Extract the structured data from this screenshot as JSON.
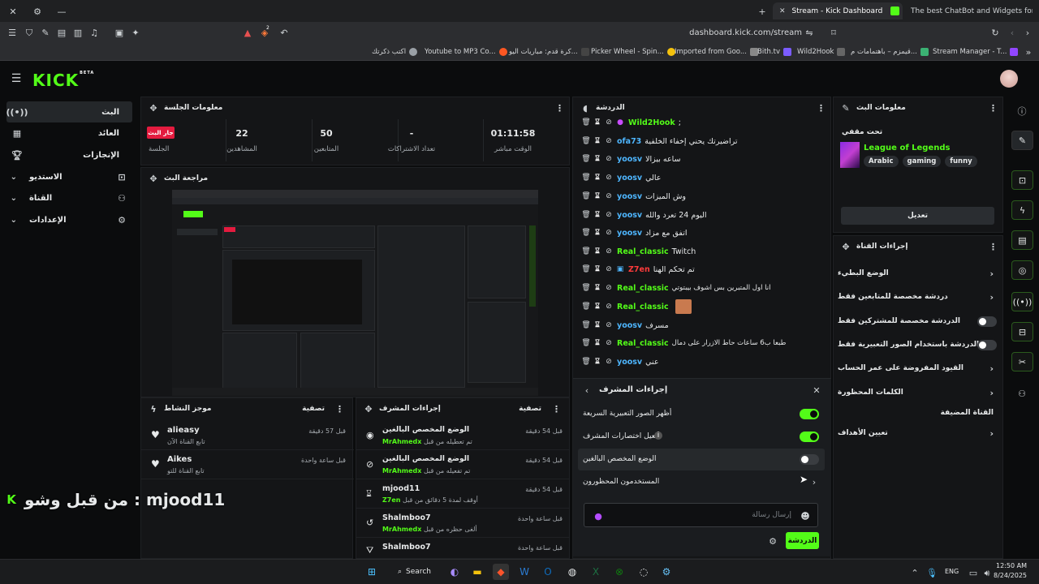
{
  "browser": {
    "tabs": [
      {
        "title": "Stream - Kick Dashboard",
        "active": true
      },
      {
        "title": "The best ChatBot and Widgets for Ki",
        "active": false
      }
    ],
    "address": "dashboard.kick.com/stream",
    "bookmarks": [
      "اكتب ذكرتك",
      "Youtube to MP3 Co...",
      "كرة قدم: مباريات اليو...",
      "Picker Wheel - Spin...",
      "Imported from Goo...",
      "Bith.tv",
      "Wild2Hook",
      "قيمزم – باهتمامات م...",
      "Stream Manager - T..."
    ],
    "ext_badge": "2"
  },
  "app": {
    "logo": "KICK",
    "logo_sup": "BETA"
  },
  "nav": [
    {
      "label": "البث",
      "icon": "broadcast-icon",
      "active": true,
      "chevron": false
    },
    {
      "label": "العائد",
      "icon": "calendar-icon",
      "active": false,
      "chevron": false
    },
    {
      "label": "الإنجازات",
      "icon": "trophy-icon",
      "active": false,
      "chevron": false
    },
    {
      "label": "الاستديو",
      "icon": "studio-icon",
      "active": false,
      "chevron": true
    },
    {
      "label": "القناة",
      "icon": "users-icon",
      "active": false,
      "chevron": true
    },
    {
      "label": "الإعدادات",
      "icon": "gear-icon",
      "active": false,
      "chevron": true
    }
  ],
  "session": {
    "title": "معلومات الجلسة",
    "live_badge": "جار البث",
    "stats": [
      {
        "value": "",
        "label": "الجلسة"
      },
      {
        "value": "22",
        "label": "المشاهدين"
      },
      {
        "value": "50",
        "label": "المتابعين"
      },
      {
        "value": "-",
        "label": "تعداد الاشتراكات"
      },
      {
        "value": "01:11:58",
        "label": "الوقت مباشر"
      }
    ]
  },
  "preview": {
    "title": "مراجعة البث"
  },
  "chat": {
    "title": "الدردشة",
    "messages": [
      {
        "user": "Wild2Hook",
        "color": "green",
        "text": ";",
        "mod": true
      },
      {
        "user": "ofa73",
        "color": "blue",
        "text": "تراضيرتك يحني إخفاء الخلفية",
        "mod": false
      },
      {
        "user": "yoosv",
        "color": "blue",
        "text": "ساعه بيزالا",
        "mod": false
      },
      {
        "user": "yoosv",
        "color": "blue",
        "text": "عالي",
        "mod": false
      },
      {
        "user": "yoosv",
        "color": "blue",
        "text": "وش الميزات",
        "mod": false
      },
      {
        "user": "yoosv",
        "color": "blue",
        "text": "اليوم 24 تعرد والله",
        "mod": false
      },
      {
        "user": "yoosv",
        "color": "blue",
        "text": "اتفق مع مزاد",
        "mod": false
      },
      {
        "user": "Real_classic",
        "color": "green",
        "text": "Twitch",
        "mod": false
      },
      {
        "user": "Z7en",
        "color": "red",
        "text": "تم تحكم الهنا",
        "mod": false
      },
      {
        "user": "Real_classic",
        "color": "green",
        "text": "انا اول المتبرين بس اشوف بيبتوتي",
        "mod": false
      },
      {
        "user": "Real_classic",
        "color": "green",
        "text": "",
        "mod": false
      },
      {
        "user": "yoosv",
        "color": "blue",
        "text": "مسرف",
        "mod": false
      },
      {
        "user": "Real_classic",
        "color": "green",
        "text": "طبعا ب6 ساعات حاط الازرار على دمال",
        "mod": false
      },
      {
        "user": "yoosv",
        "color": "blue",
        "text": "عني",
        "mod": false
      }
    ],
    "input_placeholder": "إرسال رسالة",
    "send_label": "الدردشة"
  },
  "mod_popup": {
    "title": "إجراءات المشرف",
    "options": [
      {
        "label": "أظهر الصور التعبيرية السريعة",
        "state": "on"
      },
      {
        "label": "تفعيل اختصارات المشرف",
        "state": "on",
        "info": true
      },
      {
        "label": "الوضع المخصص البالغين",
        "state": "off"
      },
      {
        "label": "المستخدمون المحظورون",
        "state": "chevron"
      }
    ]
  },
  "stream_info": {
    "title": "معلومات البث",
    "subtitle": "تحت مقفي",
    "category": "League of Legends",
    "tags": [
      "funny",
      "gaming",
      "Arabic"
    ],
    "edit_label": "تعديل"
  },
  "channel_actions": {
    "title": "إجراءات القناة",
    "rows": [
      {
        "label": "الوضع البطيء",
        "type": "chevron"
      },
      {
        "label": "دردشة مخصصة للمتابعين فقط",
        "type": "chevron"
      },
      {
        "label": "الدردشة مخصصة للمشتركين فقط",
        "type": "toggle"
      },
      {
        "label": "الدردشة باستخدام الصور التعبيرية فقط",
        "type": "toggle"
      },
      {
        "label": "القيود المفروضة على عمر الحساب",
        "type": "chevron"
      },
      {
        "label": "الكلمات المحظورة",
        "type": "chevron"
      },
      {
        "label": "القناة المضيفة",
        "type": "none"
      },
      {
        "label": "تعيين الأهداف",
        "type": "chevron"
      }
    ]
  },
  "activity": {
    "title": "موجز النشاط",
    "filter": "تصفية",
    "items": [
      {
        "user": "alieasy",
        "sub": "تابع القناة الآن",
        "time": "قبل 57 دقيقة"
      },
      {
        "user": "Aikes",
        "sub": "تابع القناة للتو",
        "time": "قبل ساعة واحدة"
      }
    ]
  },
  "mod_actions": {
    "title": "إجراءات المشرف",
    "filter": "تصفية",
    "items": [
      {
        "title": "الوضع المخصص البالغين",
        "sub": "تم تعطيله من قبل",
        "actor": "MrAhmedx",
        "time": "قبل 54 دقيقة",
        "icon": "eye-icon"
      },
      {
        "title": "الوضع المخصص البالغين",
        "sub": "تم تفعيله من قبل",
        "actor": "MrAhmedx",
        "time": "قبل 54 دقيقة",
        "icon": "eye-off-icon"
      },
      {
        "title": "mjood11",
        "sub": "أوقف لمدة 5 دقائق من قبل",
        "actor": "Z7en",
        "time": "قبل 54 دقيقة",
        "icon": "timeout-icon"
      },
      {
        "title": "Shalmboo7",
        "sub": "ألغى حظره من قبل",
        "actor": "MrAhmedx",
        "time": "قبل ساعة واحدة",
        "icon": "undo-icon"
      },
      {
        "title": "Shalmboo7",
        "sub": "",
        "actor": "",
        "time": "قبل ساعة واحدة",
        "icon": "filter-icon"
      }
    ]
  },
  "overlay": {
    "text": "من قبل وشو : mjood11",
    "k": "K"
  },
  "taskbar": {
    "search": "Search",
    "lang": "ENG",
    "time": "12:50 AM",
    "date": "8/24/2025"
  }
}
